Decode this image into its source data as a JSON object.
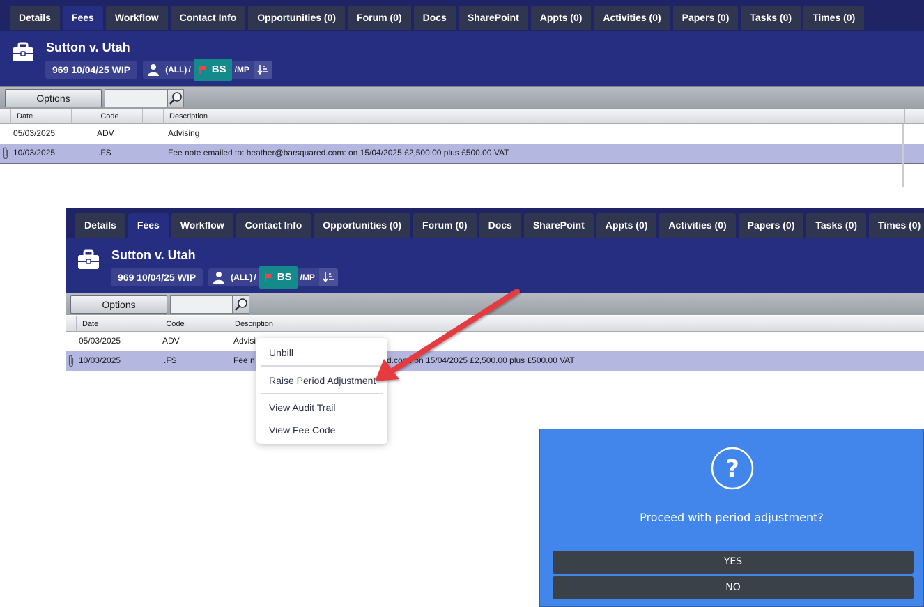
{
  "tabs": [
    "Details",
    "Fees",
    "Workflow",
    "Contact Info",
    "Opportunities (0)",
    "Forum (0)",
    "Docs",
    "SharePoint",
    "Appts (0)",
    "Activities (0)",
    "Papers (0)",
    "Tasks (0)",
    "Times (0)"
  ],
  "active_tab": "Fees",
  "matter": {
    "title": "Sutton v. Utah",
    "ref": "969 10/04/25 WIP",
    "user_filter": "(ALL)",
    "fee_earner": "BS",
    "partner": "MP",
    "separator": "/"
  },
  "toolbar": {
    "options_label": "Options",
    "search_placeholder": ""
  },
  "table": {
    "columns": [
      "Date",
      "Code",
      "Description"
    ],
    "rows": [
      {
        "date": "05/03/2025",
        "code": "ADV",
        "description": "Advising",
        "attachment": false,
        "selected": false
      },
      {
        "date": "10/03/2025",
        "code": ".FS",
        "description": "Fee note emailed to: heather@barsquared.com: on 15/04/2025 £2,500.00 plus £500.00 VAT",
        "attachment": true,
        "selected": true
      }
    ]
  },
  "second_view_row_descriptions": [
    "Advisi",
    "Fee n",
    "d.com: on 15/04/2025 £2,500.00 plus £500.00 VAT"
  ],
  "context_menu": {
    "items": [
      "Unbill",
      "Raise Period Adjustment",
      "View Audit Trail",
      "View Fee Code"
    ]
  },
  "dialog": {
    "message": "Proceed with period adjustment?",
    "yes_label": "YES",
    "no_label": "NO"
  },
  "colors": {
    "tabbar": "#1f2466",
    "header": "#262e82",
    "fee_earner_badge": "#148a8a",
    "selected_row": "#b4b7e0",
    "dialog": "#4285eb",
    "arrow": "#e53a3f"
  },
  "icons": [
    "briefcase-icon",
    "user-icon",
    "flag-icon",
    "sort-icon",
    "search-icon",
    "paperclip-icon",
    "question-icon",
    "arrow-annotation"
  ]
}
